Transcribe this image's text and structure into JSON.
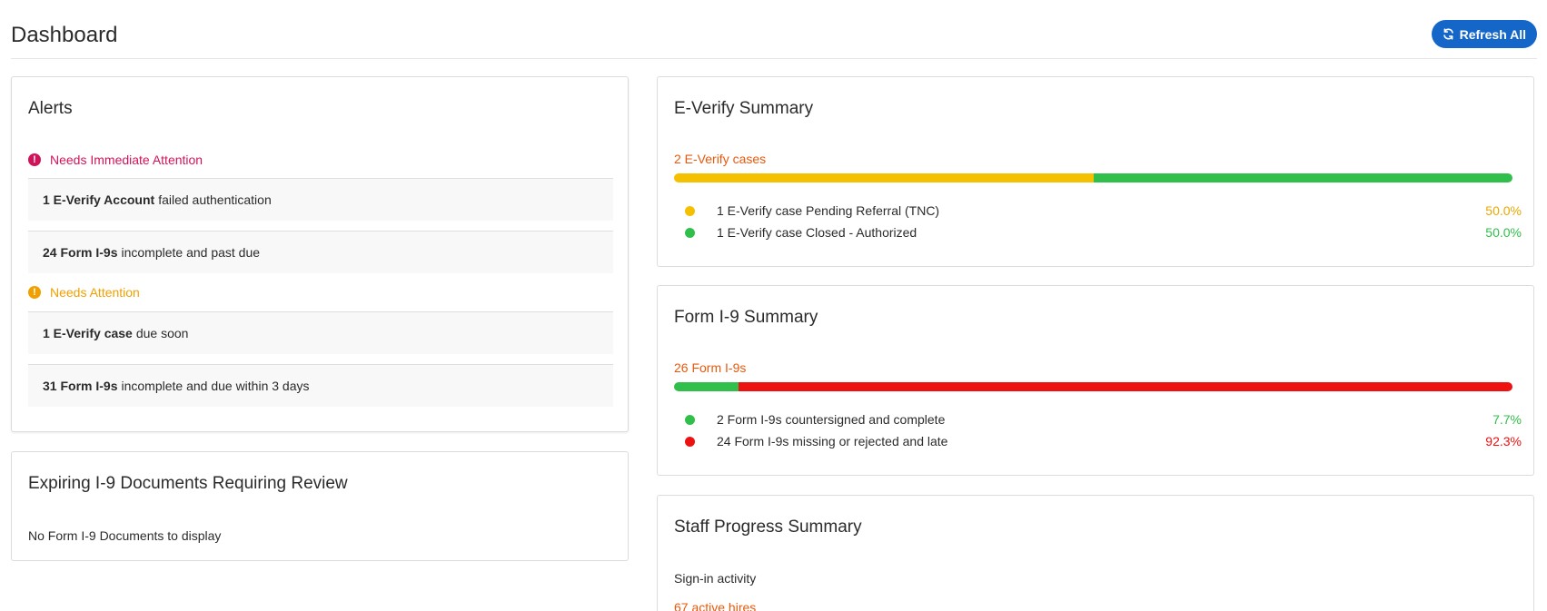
{
  "header": {
    "title": "Dashboard",
    "refresh_label": "Refresh All"
  },
  "alerts": {
    "title": "Alerts",
    "immediate": {
      "label": "Needs Immediate Attention",
      "color": "#d1145a",
      "items": [
        {
          "bold": "1 E-Verify Account",
          "text": "failed authentication"
        },
        {
          "bold": "24 Form I-9s",
          "text": "incomplete and past due"
        }
      ]
    },
    "attention": {
      "label": "Needs Attention",
      "color": "#f0a000",
      "items": [
        {
          "bold": "1 E-Verify case",
          "text": "due soon"
        },
        {
          "bold": "31 Form I-9s",
          "text": "incomplete and due within 3 days"
        }
      ]
    }
  },
  "expiring": {
    "title": "Expiring I-9 Documents Requiring Review",
    "empty_text": "No Form I-9 Documents to display"
  },
  "everify": {
    "title": "E-Verify Summary",
    "count_label": "2 E-Verify cases",
    "segments": [
      {
        "label": "1 E-Verify case Pending Referral (TNC)",
        "pct_text": "50.0%",
        "fraction": 0.5,
        "color": "#f5c000",
        "pct_color": "#e8a800"
      },
      {
        "label": "1 E-Verify case Closed - Authorized",
        "pct_text": "50.0%",
        "fraction": 0.5,
        "color": "#2fbf4a",
        "pct_color": "#2fbf4a"
      }
    ]
  },
  "formi9": {
    "title": "Form I-9 Summary",
    "count_label": "26 Form I-9s",
    "segments": [
      {
        "label": "2 Form I-9s countersigned and complete",
        "pct_text": "7.7%",
        "fraction": 0.077,
        "color": "#2fbf4a",
        "pct_color": "#2fbf4a"
      },
      {
        "label": "24 Form I-9s missing or rejected and late",
        "pct_text": "92.3%",
        "fraction": 0.923,
        "color": "#ee1111",
        "pct_color": "#ee1111"
      }
    ]
  },
  "staff": {
    "title": "Staff Progress Summary",
    "sub_label": "Sign-in activity",
    "count_label": "67 active hires"
  }
}
